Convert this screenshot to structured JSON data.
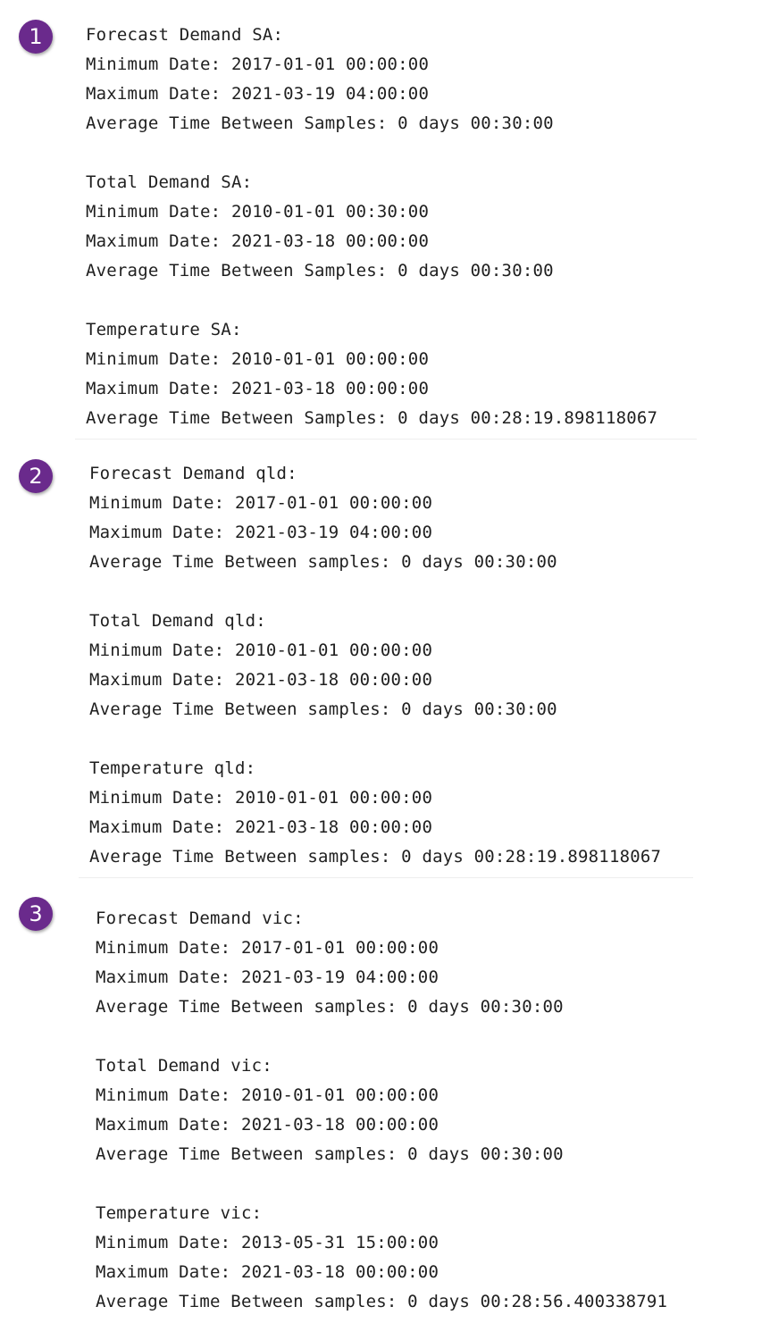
{
  "badges": {
    "one": "1",
    "two": "2",
    "three": "3"
  },
  "outputs": [
    {
      "sections": [
        {
          "title": "Forecast Demand SA:",
          "min": "Minimum Date: 2017-01-01 00:00:00",
          "max": "Maximum Date: 2021-03-19 04:00:00",
          "avg": "Average Time Between Samples: 0 days 00:30:00"
        },
        {
          "title": "Total Demand SA:",
          "min": "Minimum Date: 2010-01-01 00:30:00",
          "max": "Maximum Date: 2021-03-18 00:00:00",
          "avg": "Average Time Between Samples: 0 days 00:30:00"
        },
        {
          "title": "Temperature SA:",
          "min": "Minimum Date: 2010-01-01 00:00:00",
          "max": "Maximum Date: 2021-03-18 00:00:00",
          "avg": "Average Time Between Samples: 0 days 00:28:19.898118067"
        }
      ]
    },
    {
      "sections": [
        {
          "title": "Forecast Demand qld:",
          "min": "Minimum Date: 2017-01-01 00:00:00",
          "max": "Maximum Date: 2021-03-19 04:00:00",
          "avg": "Average Time Between samples: 0 days 00:30:00"
        },
        {
          "title": "Total Demand qld:",
          "min": "Minimum Date: 2010-01-01 00:00:00",
          "max": "Maximum Date: 2021-03-18 00:00:00",
          "avg": "Average Time Between samples: 0 days 00:30:00"
        },
        {
          "title": "Temperature qld:",
          "min": "Minimum Date: 2010-01-01 00:00:00",
          "max": "Maximum Date: 2021-03-18 00:00:00",
          "avg": "Average Time Between samples: 0 days 00:28:19.898118067"
        }
      ]
    },
    {
      "sections": [
        {
          "title": "Forecast Demand vic:",
          "min": "Minimum Date: 2017-01-01 00:00:00",
          "max": "Maximum Date: 2021-03-19 04:00:00",
          "avg": "Average Time Between samples: 0 days 00:30:00"
        },
        {
          "title": "Total Demand vic:",
          "min": "Minimum Date: 2010-01-01 00:00:00",
          "max": "Maximum Date: 2021-03-18 00:00:00",
          "avg": "Average Time Between samples: 0 days 00:30:00"
        },
        {
          "title": "Temperature vic:",
          "min": "Minimum Date: 2013-05-31 15:00:00",
          "max": "Maximum Date: 2021-03-18 00:00:00",
          "avg": "Average Time Between samples: 0 days 00:28:56.400338791"
        }
      ]
    }
  ]
}
